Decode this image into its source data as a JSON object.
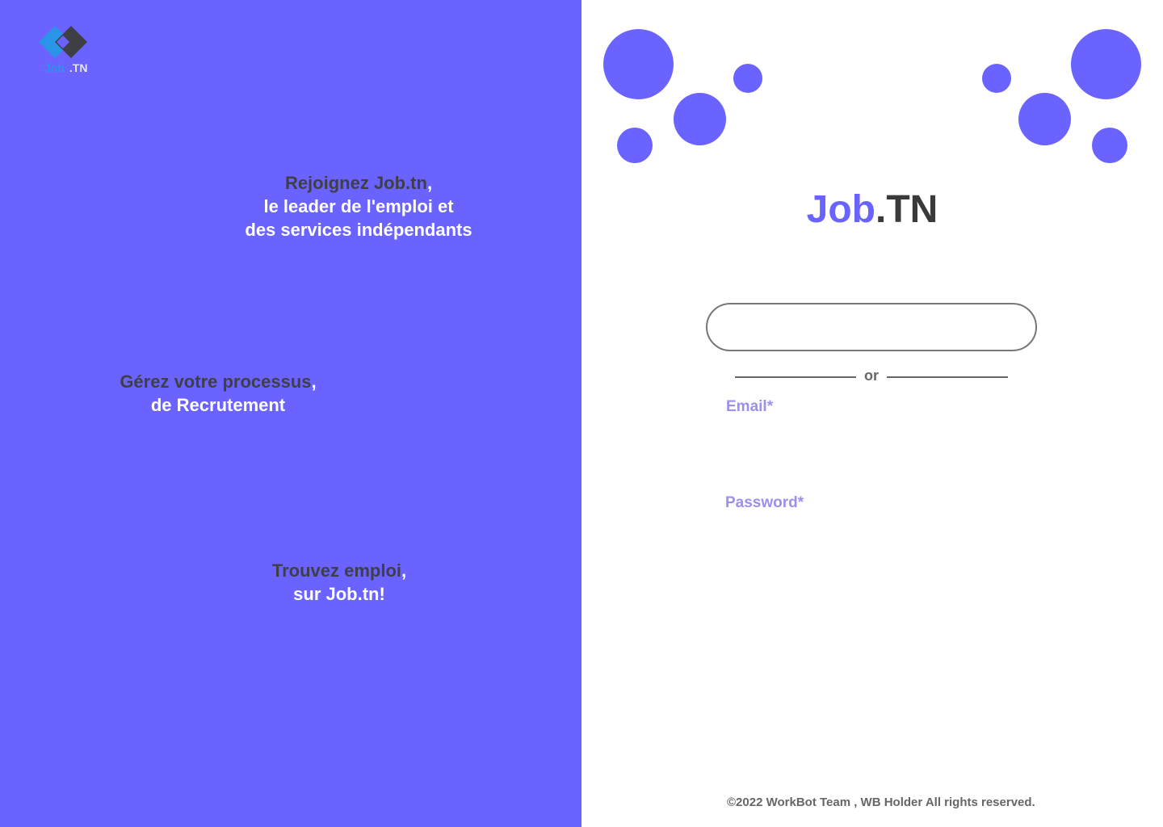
{
  "logo": {
    "part1": "Job",
    "part2": ".TN"
  },
  "taglines": {
    "t1": {
      "dark": "Rejoignez Job.tn",
      "comma": ",",
      "line2": "le leader de l'emploi et",
      "line3": "des services indépendants"
    },
    "t2": {
      "dark": "Gérez votre processus",
      "comma": ",",
      "line2": "de Recrutement"
    },
    "t3": {
      "dark": "Trouvez emploi",
      "comma": ",",
      "line2": "sur Job.tn!"
    }
  },
  "brand": {
    "part1": "Job",
    "part2": ".TN"
  },
  "login": {
    "google_button_label": "",
    "or_text": "or",
    "email_label": "Email*",
    "password_label": "Password*",
    "email_value": "",
    "password_value": ""
  },
  "footer": {
    "text": "©2022 WorkBot Team , WB Holder All rights reserved."
  },
  "colors": {
    "accent": "#6a63ff",
    "dark_text": "#3f3f46",
    "label": "#9b8ff0",
    "gray": "#666666"
  }
}
